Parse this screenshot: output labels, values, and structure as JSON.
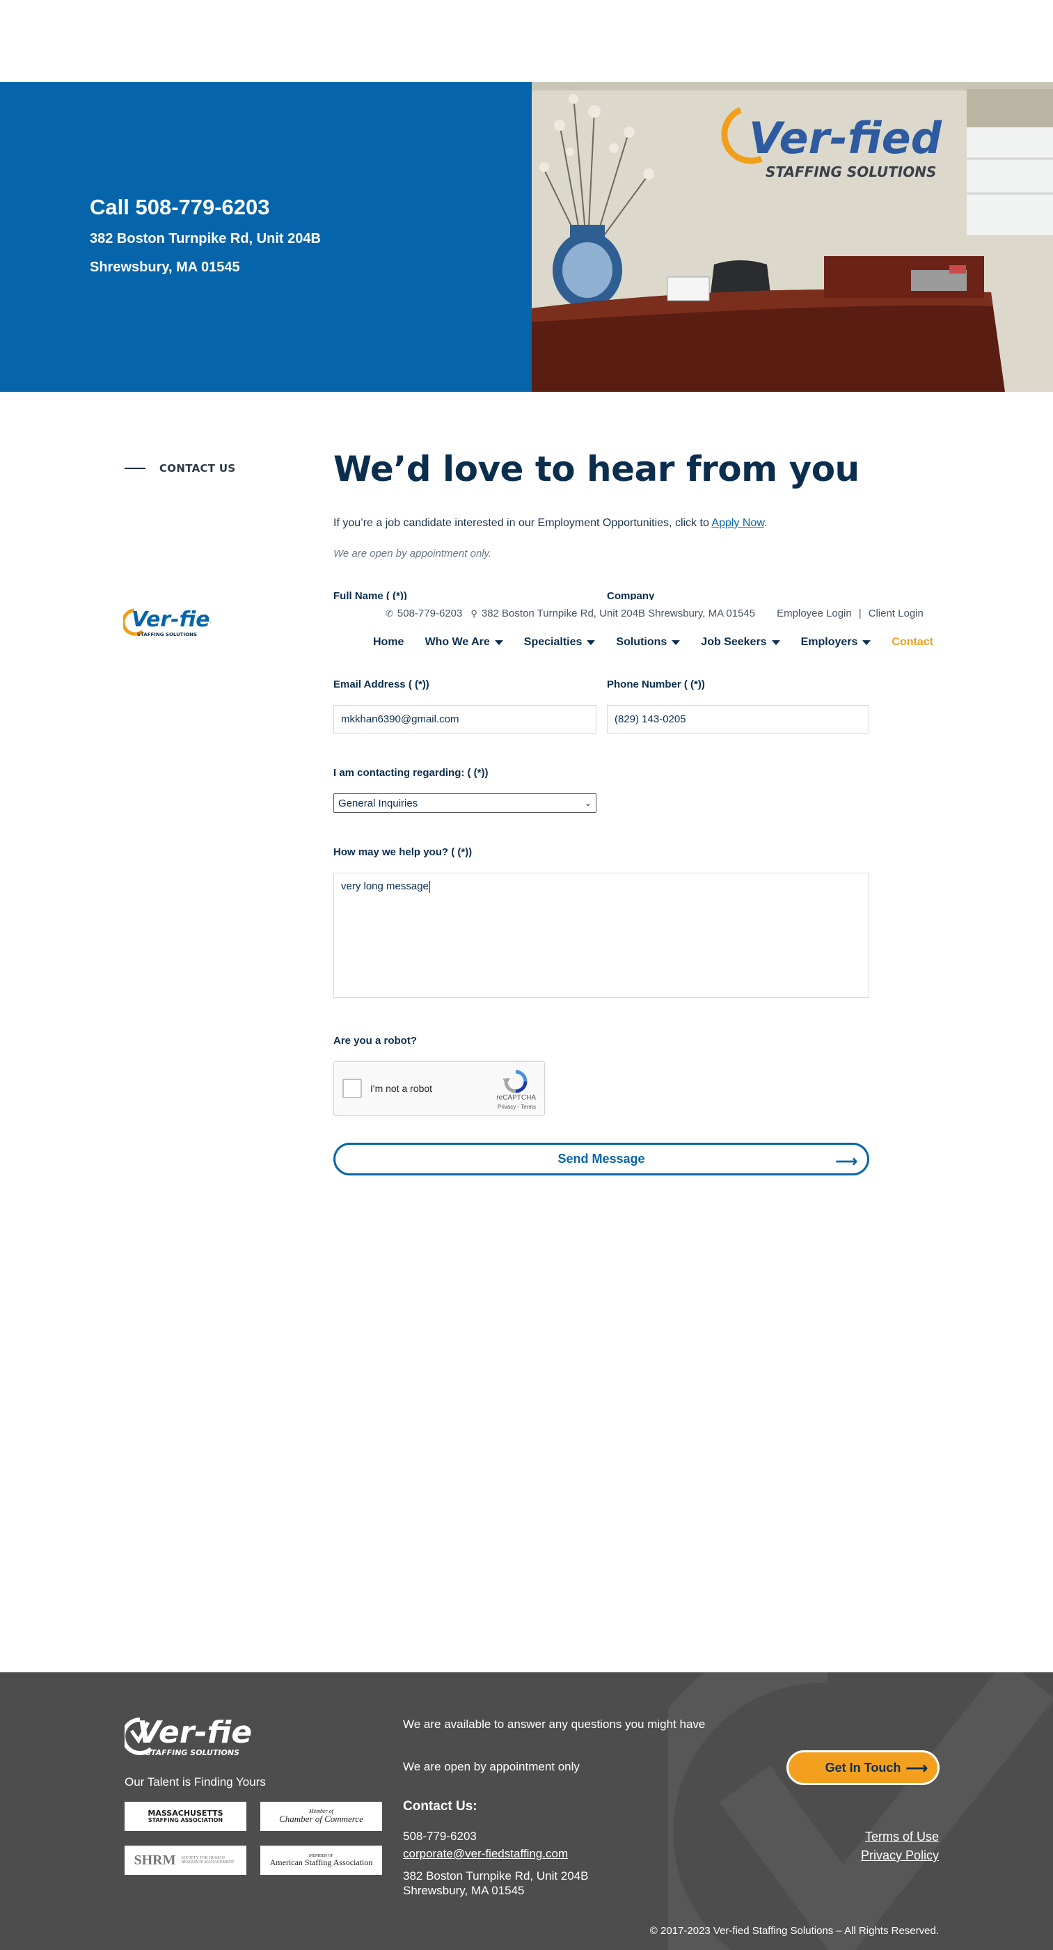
{
  "hero": {
    "call": "Call 508-779-6203",
    "address_line1": "382 Boston Turnpike Rd, Unit 204B",
    "address_line2": "Shrewsbury, MA 01545",
    "photo_logo_text": "Ver-fied",
    "photo_logo_sub": "STAFFING SOLUTIONS"
  },
  "section": {
    "label": "CONTACT US",
    "headline": "We’d love to hear from you",
    "intro_text": "If you’re a job candidate interested in our Employment Opportunities, click to ",
    "intro_link": "Apply Now",
    "intro_end": ".",
    "note": "We are open by appointment only."
  },
  "form_hidden": {
    "full_name_label": "Full Name ( (*))",
    "company_label": "Company"
  },
  "nav": {
    "logo_text": "Ver-fied",
    "logo_sub": "STAFFING SOLUTIONS",
    "phone": "508-779-6203",
    "address": "382 Boston Turnpike Rd, Unit 204B Shrewsbury, MA 01545",
    "employee_login": "Employee Login",
    "separator": "|",
    "client_login": "Client Login",
    "items": [
      {
        "label": "Home"
      },
      {
        "label": "Who We Are"
      },
      {
        "label": "Specialties"
      },
      {
        "label": "Solutions"
      },
      {
        "label": "Job Seekers"
      },
      {
        "label": "Employers"
      },
      {
        "label": "Contact"
      }
    ],
    "active_color": "#f19f1b"
  },
  "form": {
    "email_label": "Email Address ( (*))",
    "email_value": "mkkhan6390@gmail.com",
    "phone_label": "Phone Number ( (*))",
    "phone_value": "(829) 143-0205",
    "regarding_label": "I am contacting regarding: ( (*))",
    "regarding_value": "General Inquiries",
    "help_label": "How may we help you? ( (*))",
    "help_value": "very long message",
    "robot_label": "Are you a robot?",
    "recaptcha_text": "I'm not a robot",
    "recaptcha_brand": "reCAPTCHA",
    "recaptcha_terms": "Privacy - Terms",
    "send_label": "Send Message"
  },
  "footer": {
    "logo_text": "Ver-fied",
    "logo_sub": "STAFFING SOLUTIONS",
    "tagline": "Our Talent is Finding Yours",
    "badges": [
      {
        "line1": "MASSACHUSETTS",
        "line2": "STAFFING ASSOCIATION"
      },
      {
        "line1": "Member of",
        "line2": "Chamber of Commerce"
      },
      {
        "line1": "SHRM",
        "line2": "SOCIETY FOR HUMAN RESOURCE MANAGEMENT"
      },
      {
        "line1": "MEMBER OF",
        "line2": "American Staffing Association"
      }
    ],
    "available": "We are available to answer any questions you might have",
    "appointment": "We are open by appointment only",
    "contact_heading": "Contact Us:",
    "phone": "508-779-6203",
    "email": "corporate@ver-fiedstaffing.com",
    "address_line1": "382 Boston Turnpike Rd, Unit 204B",
    "address_line2": "Shrewsbury, MA 01545",
    "cta_label": "Get In Touch",
    "terms": "Terms of Use",
    "privacy": "Privacy Policy",
    "copyright": "© 2017-2023 Ver-fied Staffing Solutions – All Rights Reserved.",
    "bg_color": "#4d4d4d",
    "cta_color": "#f4a01f"
  },
  "colors": {
    "brand_blue": "#0564aa",
    "navy": "#0b2e4f",
    "orange": "#f19f1b"
  }
}
